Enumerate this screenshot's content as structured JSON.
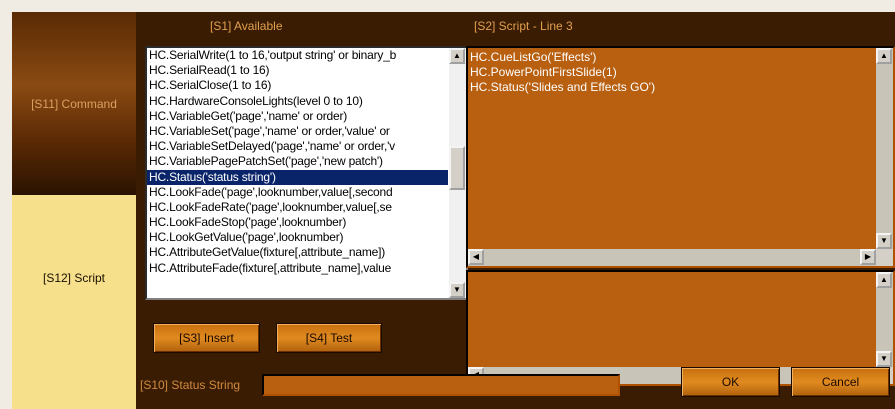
{
  "left_panel": {
    "command_label": "[S11] Command",
    "script_label": "[S12] Script"
  },
  "available": {
    "header": "[S1] Available",
    "items": [
      "HC.SerialWrite(1 to 16,'output string' or binary_b",
      "HC.SerialRead(1 to 16)",
      "HC.SerialClose(1 to 16)",
      "HC.HardwareConsoleLights(level 0 to 10)",
      "HC.VariableGet('page','name' or order)",
      "HC.VariableSet('page','name' or order,'value' or",
      "HC.VariableSetDelayed('page','name' or order,'v",
      "HC.VariablePagePatchSet('page','new patch')",
      "HC.Status('status string')",
      "HC.LookFade('page',looknumber,value[,second",
      "HC.LookFadeRate('page',looknumber,value[,se",
      "HC.LookFadeStop('page',looknumber)",
      "HC.LookGetValue('page',looknumber)",
      "HC.AttributeGetValue(fixture[,attribute_name])",
      "HC.AttributeFade(fixture[,attribute_name],value"
    ],
    "selected_index": 8
  },
  "script": {
    "header": "[S2] Script - Line 3",
    "lines": [
      "HC.CueListGo('Effects')",
      "HC.PowerPointFirstSlide(1)",
      "HC.Status('Slides and Effects GO')"
    ]
  },
  "buttons": {
    "insert": "[S3] Insert",
    "test": "[S4] Test",
    "ok": "OK",
    "cancel": "Cancel"
  },
  "status": {
    "label": "[S10] Status String",
    "value": ""
  },
  "colors": {
    "background": "#3a1c02",
    "accent": "#b85f10",
    "selected": "#0a246a",
    "label_text": "#e0a050"
  }
}
